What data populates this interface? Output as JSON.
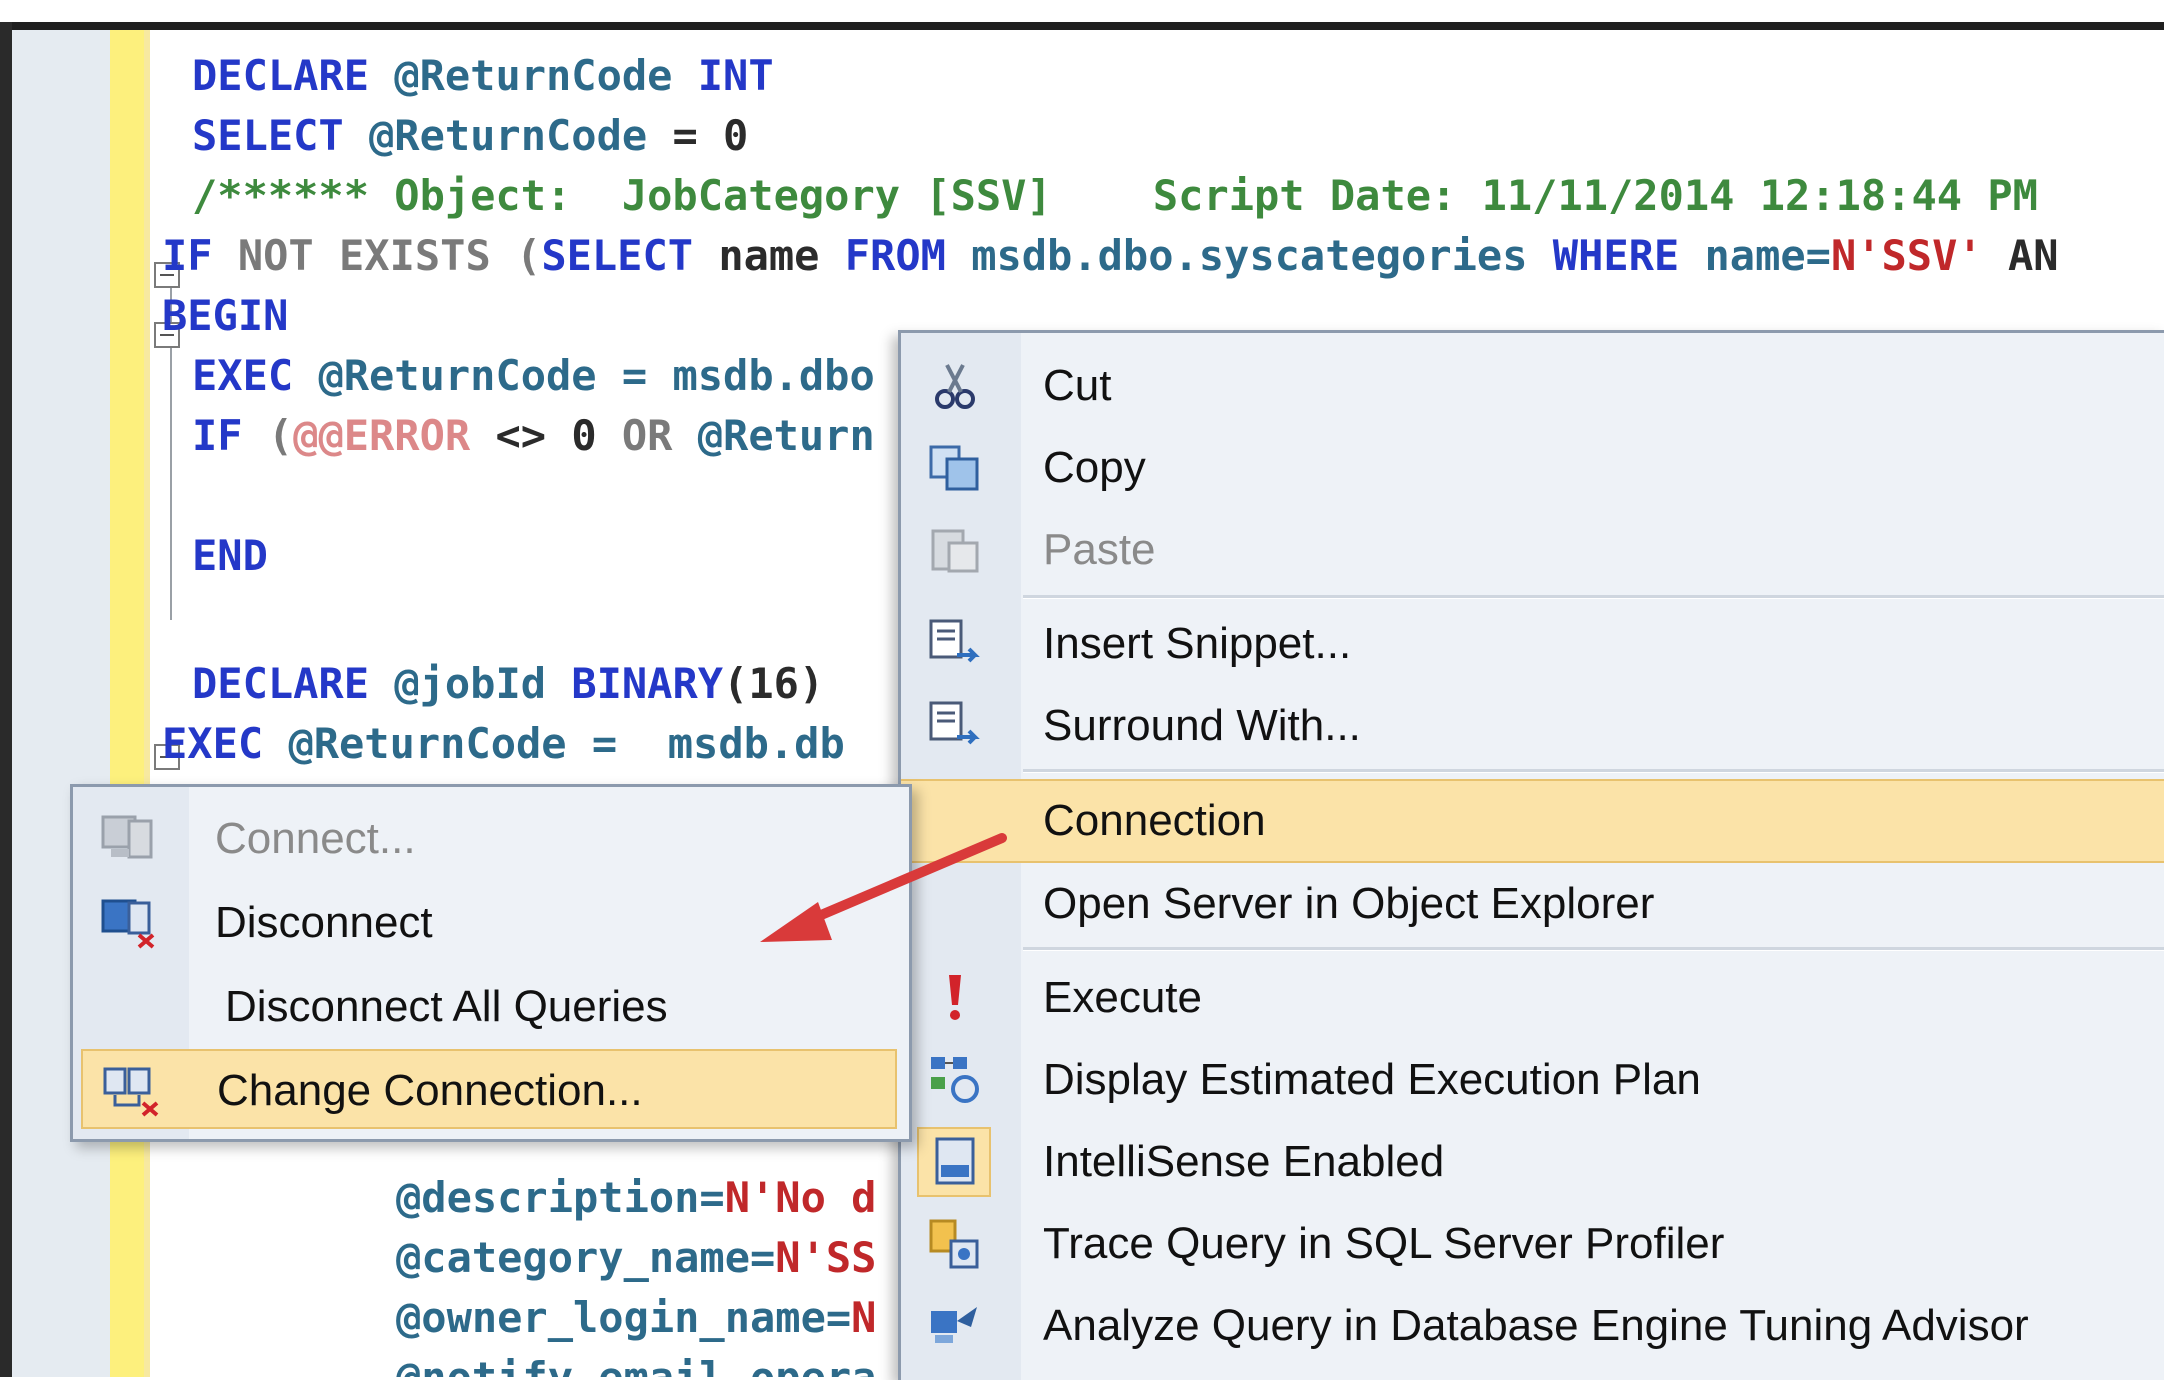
{
  "code": {
    "lines": [
      [
        "DECLARE",
        " @ReturnCode ",
        "INT"
      ],
      [
        "SELECT",
        " @ReturnCode ",
        "= 0"
      ],
      [
        "/****** Object:  JobCategory [SSV]    Script Date: 11/11/2014 12:18:44 PM"
      ],
      [
        "IF",
        " NOT EXISTS (",
        "SELECT",
        " name ",
        "FROM",
        " msdb.dbo.syscategories ",
        "WHERE",
        " name=",
        "N'SSV'",
        " AN"
      ],
      [
        "BEGIN"
      ],
      [
        "EXEC",
        " @ReturnCode ",
        "= msdb.dbo"
      ],
      [
        "IF",
        " (",
        "@@ERROR",
        " <> 0 ",
        "OR",
        " @Return"
      ],
      [
        "END"
      ],
      [
        "DECLARE",
        " @jobId ",
        "BINARY",
        "(16)"
      ],
      [
        "EXEC",
        " @ReturnCode ",
        "=  msdb.db"
      ],
      [
        "@description=",
        "N'No d"
      ],
      [
        "@category_name=",
        "N'SS"
      ],
      [
        "@owner_login_name=",
        "N"
      ],
      [
        "@notify_email_opera"
      ]
    ]
  },
  "context_menu": {
    "items": [
      {
        "label": "Cut",
        "icon": "scissors-icon",
        "enabled": true
      },
      {
        "label": "Copy",
        "icon": "copy-icon",
        "enabled": true
      },
      {
        "label": "Paste",
        "icon": "paste-icon",
        "enabled": false
      },
      {
        "label": "Insert Snippet...",
        "icon": "insert-snippet-icon",
        "enabled": true
      },
      {
        "label": "Surround With...",
        "icon": "surround-with-icon",
        "enabled": true
      },
      {
        "label": "Connection",
        "icon": "",
        "enabled": true,
        "highlighted": true
      },
      {
        "label": "Open Server in Object Explorer",
        "icon": "",
        "enabled": true
      },
      {
        "label": "Execute",
        "icon": "execute-icon",
        "enabled": true
      },
      {
        "label": "Display Estimated Execution Plan",
        "icon": "execution-plan-icon",
        "enabled": true
      },
      {
        "label": "IntelliSense Enabled",
        "icon": "intellisense-icon",
        "enabled": true,
        "checked": true
      },
      {
        "label": "Trace Query in SQL Server Profiler",
        "icon": "profiler-icon",
        "enabled": true
      },
      {
        "label": "Analyze Query in Database Engine Tuning Advisor",
        "icon": "tuning-advisor-icon",
        "enabled": true
      }
    ]
  },
  "submenu": {
    "items": [
      {
        "label": "Connect...",
        "icon": "connect-icon",
        "enabled": false
      },
      {
        "label": "Disconnect",
        "icon": "disconnect-icon",
        "enabled": true
      },
      {
        "label": "Disconnect All Queries",
        "icon": "",
        "enabled": true
      },
      {
        "label": "Change Connection...",
        "icon": "change-connection-icon",
        "enabled": true,
        "highlighted": true
      }
    ]
  },
  "colors": {
    "menu_bg": "#eef2f7",
    "highlight": "#fbe3a8",
    "keyword": "#2438c8",
    "string": "#c0282a",
    "comment": "#3e8a3e",
    "arrow": "#d93a3a"
  }
}
